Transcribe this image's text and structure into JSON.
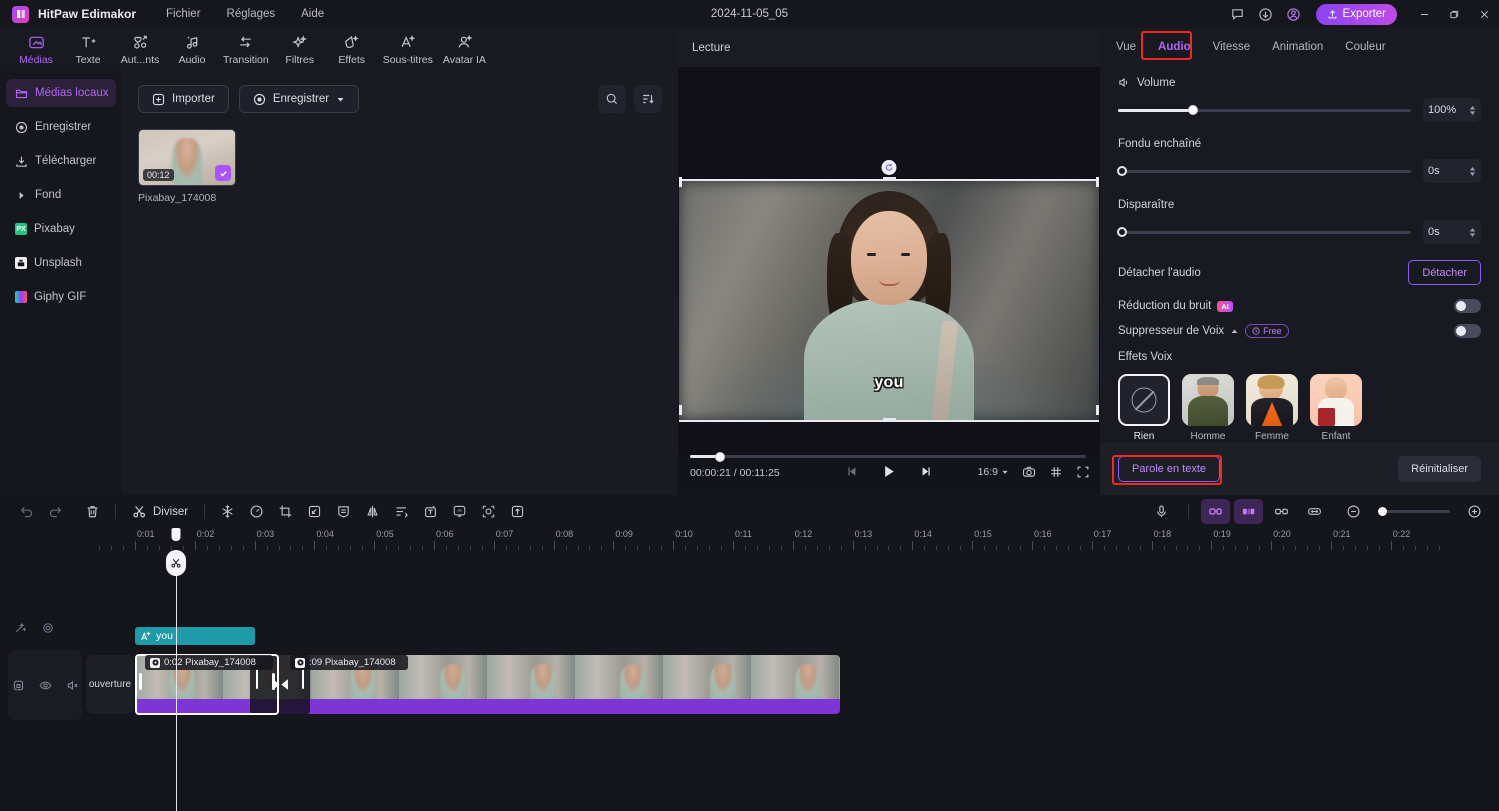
{
  "titlebar": {
    "app_name": "HitPaw Edimakor",
    "menus": [
      "Fichier",
      "Réglages",
      "Aide"
    ],
    "doc_title": "2024-11-05_05",
    "export_label": "Exporter",
    "icons": [
      "feedback-icon",
      "download-icon",
      "account-icon"
    ],
    "window_controls": [
      "minimize",
      "restore",
      "close"
    ]
  },
  "ribbon": {
    "items": [
      {
        "label": "Médias",
        "icon": "media-icon",
        "active": true
      },
      {
        "label": "Texte",
        "icon": "text-icon",
        "active": false
      },
      {
        "label": "Aut...nts",
        "icon": "elements-icon",
        "active": false
      },
      {
        "label": "Audio",
        "icon": "audio-icon",
        "active": false
      },
      {
        "label": "Transition",
        "icon": "transition-icon",
        "active": false
      },
      {
        "label": "Filtres",
        "icon": "filters-icon",
        "active": false
      },
      {
        "label": "Effets",
        "icon": "effects-icon",
        "active": false
      },
      {
        "label": "Sous-titres",
        "icon": "subtitles-icon",
        "active": false
      },
      {
        "label": "Avatar IA",
        "icon": "ai-avatar-icon",
        "active": false
      }
    ]
  },
  "sidebar": {
    "items": [
      {
        "label": "Médias locaux",
        "icon": "folder-icon",
        "active": true
      },
      {
        "label": "Enregistrer",
        "icon": "record-icon",
        "active": false
      },
      {
        "label": "Télécharger",
        "icon": "download-icon",
        "active": false
      },
      {
        "label": "Fond",
        "icon": "chevron-right-icon",
        "active": false
      },
      {
        "label": "Pixabay",
        "icon": "pixabay-icon",
        "active": false,
        "brand_color": "#26c281",
        "brand_letter": "PX"
      },
      {
        "label": "Unsplash",
        "icon": "unsplash-icon",
        "active": false,
        "brand_color": "#e8e8ee",
        "brand_letter": "U"
      },
      {
        "label": "Giphy GIF",
        "icon": "giphy-icon",
        "active": false,
        "brand_color": "#111118",
        "brand_letter": "G"
      }
    ]
  },
  "media_panel": {
    "import_label": "Importer",
    "record_label": "Enregistrer",
    "search_icon": "search-icon",
    "sort_icon": "sort-list-icon",
    "items": [
      {
        "name": "Pixabay_174008",
        "duration": "00:12",
        "selected": true
      }
    ]
  },
  "preview": {
    "header_label": "Lecture",
    "subtitle_text": "you",
    "current_time": "00:00:21",
    "total_time": "00:11:25",
    "time_separator": "/",
    "aspect_ratio": "16:9",
    "progress_percent": 6,
    "controls": [
      "prev-frame-icon",
      "play-icon",
      "next-frame-icon"
    ],
    "right_icons": [
      "snapshot-icon",
      "grid-icon",
      "fullscreen-icon"
    ]
  },
  "right_panel": {
    "tabs": [
      {
        "label": "Vue",
        "active": false
      },
      {
        "label": "Audio",
        "active": true
      },
      {
        "label": "Vitesse",
        "active": false
      },
      {
        "label": "Animation",
        "active": false
      },
      {
        "label": "Couleur",
        "active": false
      }
    ],
    "volume": {
      "label": "Volume",
      "icon": "speaker-icon",
      "value": "100%",
      "percent": 26
    },
    "fade_in": {
      "label": "Fondu enchaîné",
      "value": "0s",
      "percent": 0
    },
    "fade_out": {
      "label": "Disparaître",
      "value": "0s",
      "percent": 0
    },
    "detach": {
      "label": "Détacher l'audio",
      "button": "Détacher"
    },
    "noise_reduction": {
      "label": "Réduction du bruit",
      "badge": "AI",
      "enabled": false
    },
    "voice_remover": {
      "label": "Suppresseur de Voix",
      "badge": "Free",
      "badge_icon": "clock-icon",
      "enabled": false
    },
    "voice_effects": {
      "label": "Effets Voix",
      "items": [
        {
          "label": "Rien",
          "selected": true,
          "icon": "none-icon"
        },
        {
          "label": "Homme",
          "selected": false
        },
        {
          "label": "Femme",
          "selected": false
        },
        {
          "label": "Enfant",
          "selected": false
        }
      ]
    },
    "footer": {
      "speech_to_text": "Parole en texte",
      "reset": "Réinitialiser"
    }
  },
  "timeline": {
    "toolbar": {
      "undo_icon": "undo-icon",
      "redo_icon": "redo-icon",
      "delete_icon": "trash-icon",
      "split_label": "Diviser",
      "split_icon": "scissors-icon",
      "tools": [
        "freeze-frame-icon",
        "speed-icon",
        "crop-icon",
        "pip-icon",
        "mask-icon",
        "mirror-icon",
        "align-icon",
        "add-text-icon",
        "ai-icon",
        "tracking-icon",
        "export-clip-icon"
      ],
      "right_tools": [
        "microphone-icon",
        "link-icon",
        "adjust-icon",
        "unlink-icon",
        "fit-icon",
        "zoom-out-icon",
        "zoom-in-icon"
      ],
      "zoom_percent": 3
    },
    "ruler_labels": [
      "0:01",
      "0:02",
      "0:03",
      "0:04",
      "0:05",
      "0:06",
      "0:07",
      "0:08",
      "0:09",
      "0:10",
      "0:11",
      "0:12",
      "0:13",
      "0:14",
      "0:15",
      "0:16",
      "0:17",
      "0:18",
      "0:19",
      "0:20",
      "0:21",
      "0:22"
    ],
    "text_track": {
      "head_icons": [
        "magic-wand-icon",
        "target-icon"
      ],
      "clip": {
        "label": "you",
        "icon": "text-style-icon"
      }
    },
    "video_track": {
      "head_icons": [
        "lock-icon",
        "eye-icon",
        "mute-icon"
      ],
      "opening_clip": "ouverture",
      "clips": [
        {
          "label": "0:02 Pixabay_174008",
          "selected": true
        },
        {
          "label": ":09 Pixabay_174008",
          "selected": false
        }
      ],
      "transition_icon": "transition-bowtie-icon"
    },
    "playhead_icon": "scissors-icon"
  },
  "colors": {
    "accent": "#b366f5",
    "accent_purple": "#8b5cf6",
    "highlight_red": "#ec2a22",
    "audio_bar": "#7d35d6",
    "text_clip": "#1f9aa8"
  }
}
